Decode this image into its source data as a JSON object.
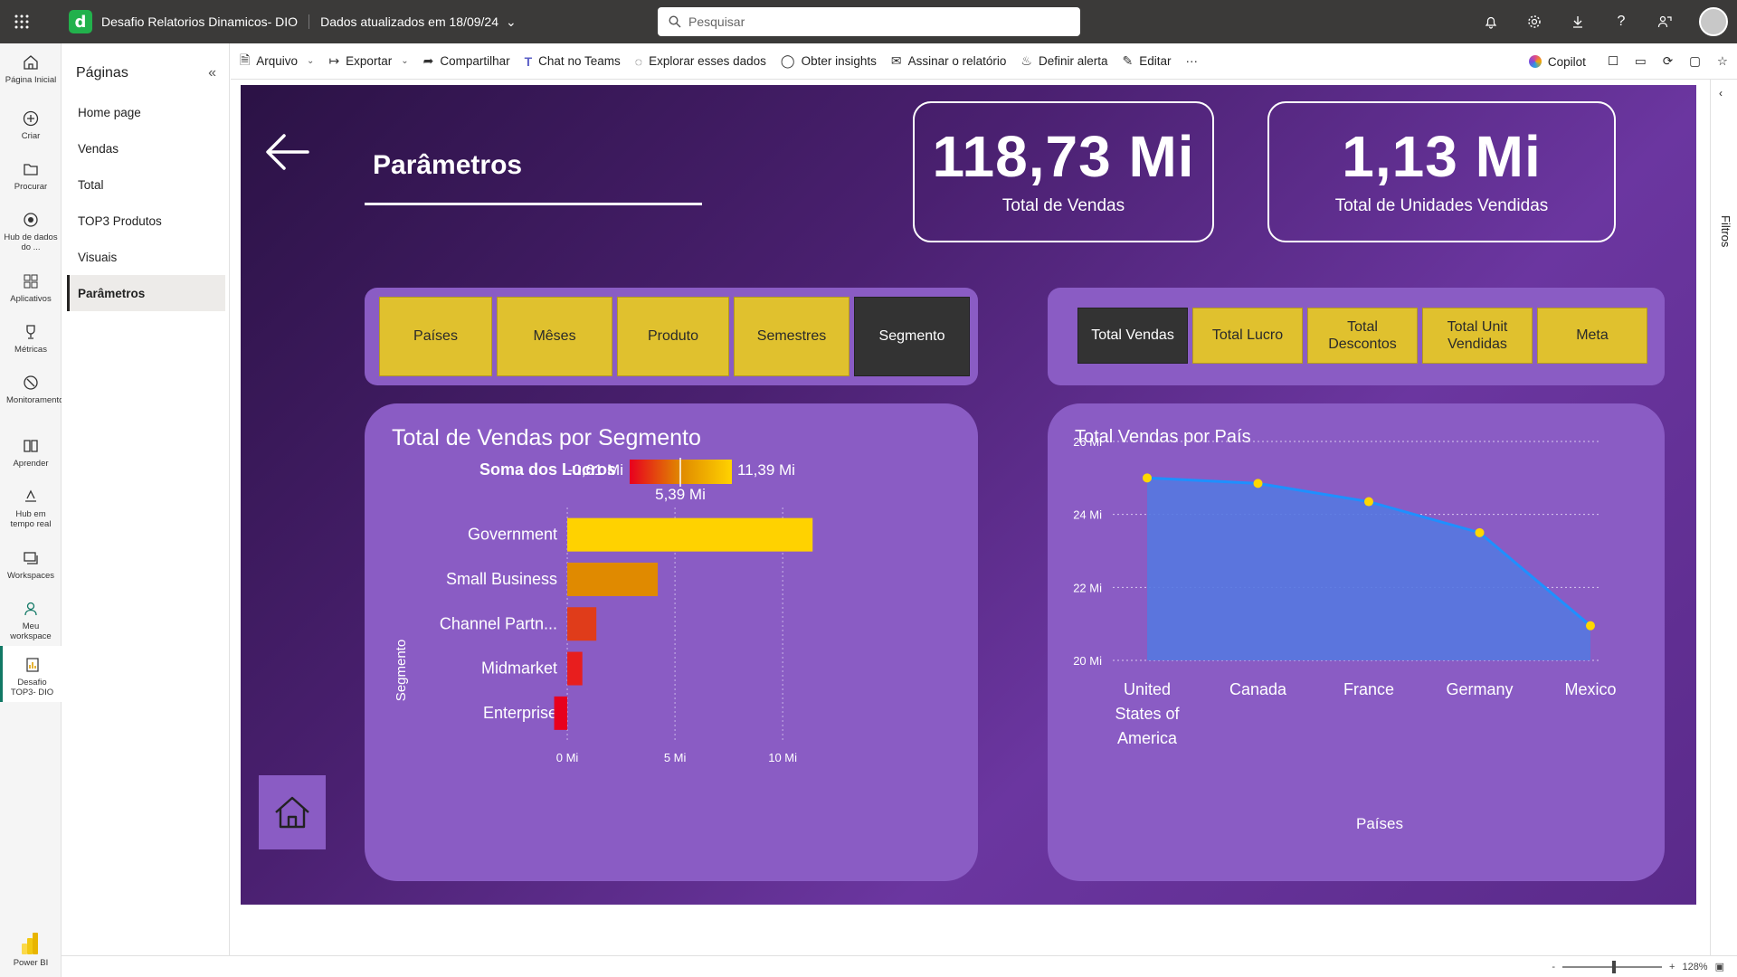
{
  "topbar": {
    "report_title": "Desafio Relatorios Dinamicos- DIO",
    "data_updated": "Dados atualizados em 18/09/24",
    "search_placeholder": "Pesquisar"
  },
  "leftnav": {
    "items": [
      {
        "label": "Página Inicial",
        "icon": "home-icon"
      },
      {
        "label": "Criar",
        "icon": "plus-circle-icon"
      },
      {
        "label": "Procurar",
        "icon": "folder-icon"
      },
      {
        "label": "Hub de dados do ...",
        "icon": "data-hub-icon"
      },
      {
        "label": "Aplicativos",
        "icon": "apps-icon"
      },
      {
        "label": "Métricas",
        "icon": "trophy-icon"
      },
      {
        "label": "Monitoramento",
        "icon": "monitor-icon"
      },
      {
        "label": "Aprender",
        "icon": "book-icon"
      },
      {
        "label": "Hub em tempo real",
        "icon": "realtime-icon"
      },
      {
        "label": "Workspaces",
        "icon": "workspaces-icon"
      },
      {
        "label": "Meu workspace",
        "icon": "person-icon"
      },
      {
        "label": "Desafio TOP3- DIO",
        "icon": "report-icon"
      }
    ],
    "footer": "Power BI"
  },
  "pages": {
    "header": "Páginas",
    "items": [
      "Home page",
      "Vendas",
      "Total",
      "TOP3 Produtos",
      "Visuais",
      "Parâmetros"
    ],
    "active": "Parâmetros"
  },
  "toolbar": {
    "arquivo": "Arquivo",
    "exportar": "Exportar",
    "compartilhar": "Compartilhar",
    "chat_teams": "Chat no Teams",
    "explorar": "Explorar esses dados",
    "insights": "Obter insights",
    "assinar": "Assinar o relatório",
    "alerta": "Definir alerta",
    "editar": "Editar",
    "more": "···",
    "copilot": "Copilot"
  },
  "filters": {
    "label": "Filtros"
  },
  "status": {
    "zoom": "128%",
    "minus": "-",
    "plus": "+"
  },
  "report": {
    "title": "Parâmetros",
    "kpis": [
      {
        "value": "118,73 Mi",
        "label": "Total de Vendas"
      },
      {
        "value": "1,13 Mi",
        "label": "Total de Unidades Vendidas"
      }
    ],
    "dimension_slicer": {
      "options": [
        "Países",
        "Mêses",
        "Produto",
        "Semestres",
        "Segmento"
      ],
      "selected": "Segmento"
    },
    "measure_slicer": {
      "options": [
        "Total Vendas",
        "Total Lucro",
        "Total Descontos",
        "Total Unit Vendidas",
        "Meta"
      ],
      "selected": "Total Vendas"
    },
    "bar_chart": {
      "title": "Total de Vendas por Segmento",
      "legend_label": "Soma dos Lucros",
      "legend_min": "-0,61 Mi",
      "legend_max": "11,39 Mi",
      "legend_mid": "5,39 Mi",
      "axis_label": "Segmento"
    },
    "line_chart": {
      "title": "Total Vendas por País",
      "xlabel": "Países"
    }
  },
  "colors": {
    "accent_yellow": "#e0c12e",
    "selected_dark": "#333333",
    "panel_purple": "#8a5cc4",
    "area_blue": "#5578e0",
    "line_blue": "#1e90ff",
    "point_yellow": "#ffd700"
  },
  "chart_data": [
    {
      "type": "bar",
      "orientation": "horizontal",
      "title": "Total de Vendas por Segmento",
      "ylabel": "Segmento",
      "categories": [
        "Government",
        "Small Business",
        "Channel Partn...",
        "Midmarket",
        "Enterprise"
      ],
      "values": [
        11.39,
        4.2,
        1.35,
        0.7,
        -0.61
      ],
      "color_values_lucro": [
        11.39,
        4.2,
        1.35,
        0.7,
        -0.61
      ],
      "bar_colors": [
        "#ffd200",
        "#e08a00",
        "#e03c1a",
        "#e81e1e",
        "#e8001e"
      ],
      "xticks": [
        "0 Mi",
        "5 Mi",
        "10 Mi"
      ],
      "xtick_values": [
        0,
        5,
        10
      ],
      "xlim": [
        -0.8,
        11.8
      ],
      "grid": true
    },
    {
      "type": "area",
      "title": "Total Vendas por País",
      "xlabel": "Países",
      "categories": [
        "United States of America",
        "Canada",
        "France",
        "Germany",
        "Mexico"
      ],
      "values": [
        25.0,
        24.85,
        24.35,
        23.5,
        20.95
      ],
      "yticks": [
        "20 Mi",
        "22 Mi",
        "24 Mi",
        "26 Mi"
      ],
      "ytick_values": [
        20,
        22,
        24,
        26
      ],
      "ylim": [
        20,
        26
      ],
      "grid": true
    }
  ]
}
